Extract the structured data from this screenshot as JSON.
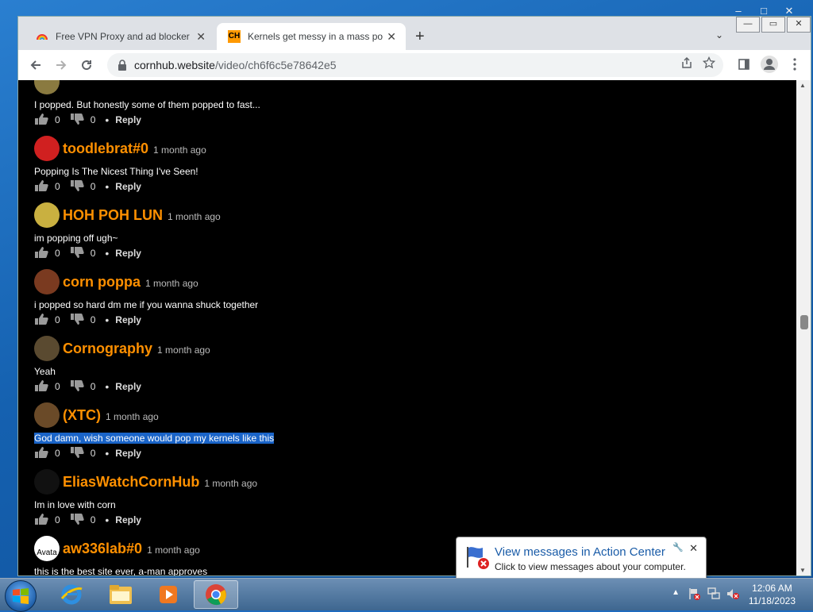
{
  "outer_window": {
    "controls": [
      "–",
      "□",
      "✕"
    ]
  },
  "browser": {
    "window_controls": [
      "—",
      "▭",
      "✕"
    ],
    "tabs": [
      {
        "title": "Free VPN Proxy and ad blocker -",
        "active": false
      },
      {
        "title": "Kernels get messy in a mass popp",
        "active": true,
        "favicon_text": "CH"
      }
    ],
    "new_tab": "+",
    "tab_menu": "⌄",
    "url": {
      "host": "cornhub.website",
      "path": "/video/ch6f6c5e78642e5"
    }
  },
  "comments": [
    {
      "user": "",
      "age": "",
      "text": "I popped. But honestly some of them popped to fast...",
      "likes": "0",
      "dislikes": "0",
      "reply": "Reply",
      "avatar_color": "#8a7a40"
    },
    {
      "user": "toodlebrat#0",
      "age": "1 month ago",
      "text": "Popping Is The Nicest Thing I've Seen!",
      "likes": "0",
      "dislikes": "0",
      "reply": "Reply",
      "avatar_color": "#d02020"
    },
    {
      "user": "HOH POH LUN",
      "age": "1 month ago",
      "text": "im popping off ugh~",
      "likes": "0",
      "dislikes": "0",
      "reply": "Reply",
      "avatar_color": "#c9b040"
    },
    {
      "user": "corn poppa",
      "age": "1 month ago",
      "text": "i popped so hard dm me if you wanna shuck together",
      "likes": "0",
      "dislikes": "0",
      "reply": "Reply",
      "avatar_color": "#7a3a20"
    },
    {
      "user": "Cornography",
      "age": "1 month ago",
      "text": "Yeah",
      "likes": "0",
      "dislikes": "0",
      "reply": "Reply",
      "avatar_color": "#5a4a30"
    },
    {
      "user": "(XTC)",
      "age": "1 month ago",
      "text": "God damn, wish someone would pop my kernels like this",
      "likes": "0",
      "dislikes": "0",
      "reply": "Reply",
      "avatar_color": "#6a4a28",
      "selected": true
    },
    {
      "user": "EliasWatchCornHub",
      "age": "1 month ago",
      "text": "Im in love with corn",
      "likes": "0",
      "dislikes": "0",
      "reply": "Reply",
      "avatar_color": "#111111"
    },
    {
      "user": "aw336lab#0",
      "age": "1 month ago",
      "text": "this is the best site ever, a-man approves",
      "likes": "0",
      "dislikes": "0",
      "reply": "Reply",
      "avatar_color": "#ffffff",
      "avatar_alt": "Avata"
    }
  ],
  "notification": {
    "title": "View messages in Action Center",
    "subtitle": "Click to view messages about your computer.",
    "close": "✕"
  },
  "clock": {
    "time": "12:06 AM",
    "date": "11/18/2023"
  },
  "colors": {
    "username": "#ff9000",
    "page_bg": "#000000",
    "selection": "#1a64c8"
  }
}
